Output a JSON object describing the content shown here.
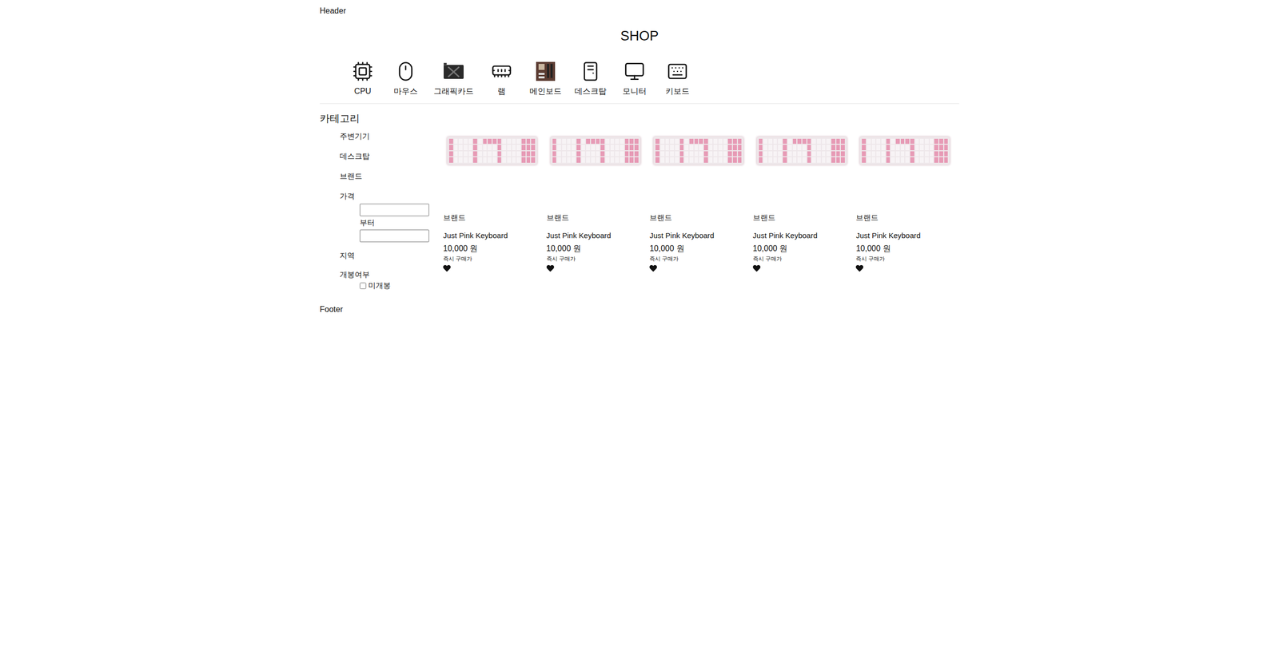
{
  "header": "Header",
  "title": "SHOP",
  "categories": [
    {
      "label": "CPU"
    },
    {
      "label": "마우스"
    },
    {
      "label": "그래픽카드"
    },
    {
      "label": "램"
    },
    {
      "label": "메인보드"
    },
    {
      "label": "데스크탑"
    },
    {
      "label": "모니터"
    },
    {
      "label": "키보드"
    }
  ],
  "sidebar": {
    "title": "카테고리",
    "items": [
      "주변기기",
      "데스크탑",
      "브랜드"
    ],
    "price": {
      "label": "가격",
      "from_value": "",
      "between": "부터",
      "to_value": ""
    },
    "region": "지역",
    "opened": {
      "label": "개봉여부",
      "options": [
        {
          "label": "미개봉",
          "checked": false
        }
      ]
    }
  },
  "products": [
    {
      "brand": "브랜드",
      "name": "Just Pink Keyboard",
      "price": "10,000 원",
      "note": "즉시 구매가"
    },
    {
      "brand": "브랜드",
      "name": "Just Pink Keyboard",
      "price": "10,000 원",
      "note": "즉시 구매가"
    },
    {
      "brand": "브랜드",
      "name": "Just Pink Keyboard",
      "price": "10,000 원",
      "note": "즉시 구매가"
    },
    {
      "brand": "브랜드",
      "name": "Just Pink Keyboard",
      "price": "10,000 원",
      "note": "즉시 구매가"
    },
    {
      "brand": "브랜드",
      "name": "Just Pink Keyboard",
      "price": "10,000 원",
      "note": "즉시 구매가"
    }
  ],
  "footer": "Footer"
}
